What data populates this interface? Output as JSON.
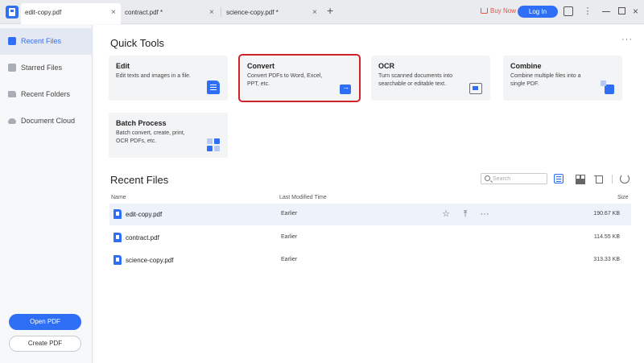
{
  "tabs": [
    {
      "label": "edit-copy.pdf",
      "active": true
    },
    {
      "label": "contract.pdf *",
      "active": false
    },
    {
      "label": "science-copy.pdf *",
      "active": false
    }
  ],
  "header": {
    "buy_now": "Buy Now",
    "login": "Log In",
    "close_glyph": "×",
    "new_tab_glyph": "+"
  },
  "sidebar": {
    "items": [
      {
        "label": "Recent Files",
        "active": true
      },
      {
        "label": "Starred Files",
        "active": false
      },
      {
        "label": "Recent Folders",
        "active": false
      },
      {
        "label": "Document Cloud",
        "active": false
      }
    ],
    "open_pdf": "Open PDF",
    "create_pdf": "Create PDF"
  },
  "main": {
    "quick_tools_title": "Quick Tools",
    "more_glyph": "···",
    "tools": [
      {
        "title": "Edit",
        "desc": "Edit texts and images in a file.",
        "selected": false
      },
      {
        "title": "Convert",
        "desc": "Convert PDFs to Word, Excel, PPT, etc.",
        "selected": true
      },
      {
        "title": "OCR",
        "desc": "Turn scanned documents into searchable or editable text.",
        "selected": false
      },
      {
        "title": "Combine",
        "desc": "Combine multiple files into a single PDF.",
        "selected": false
      },
      {
        "title": "Batch Process",
        "desc": "Batch convert, create, print, OCR PDFs, etc.",
        "selected": false
      }
    ],
    "recent_title": "Recent Files",
    "search_placeholder": "Search",
    "columns": {
      "name": "Name",
      "modified": "Last Modified Time",
      "size": "Size"
    },
    "files": [
      {
        "name": "edit-copy.pdf",
        "modified": "Earlier",
        "size": "190.67 KB"
      },
      {
        "name": "contract.pdf",
        "modified": "Earlier",
        "size": "114.55 KB"
      },
      {
        "name": "science-copy.pdf",
        "modified": "Earlier",
        "size": "313.33 KB"
      }
    ],
    "row_actions": {
      "star": "☆",
      "share": "⤒",
      "more": "···"
    }
  },
  "colors": {
    "accent": "#2f6ff5",
    "buy_now": "#e8523f",
    "selected_outline": "#d0222b"
  }
}
